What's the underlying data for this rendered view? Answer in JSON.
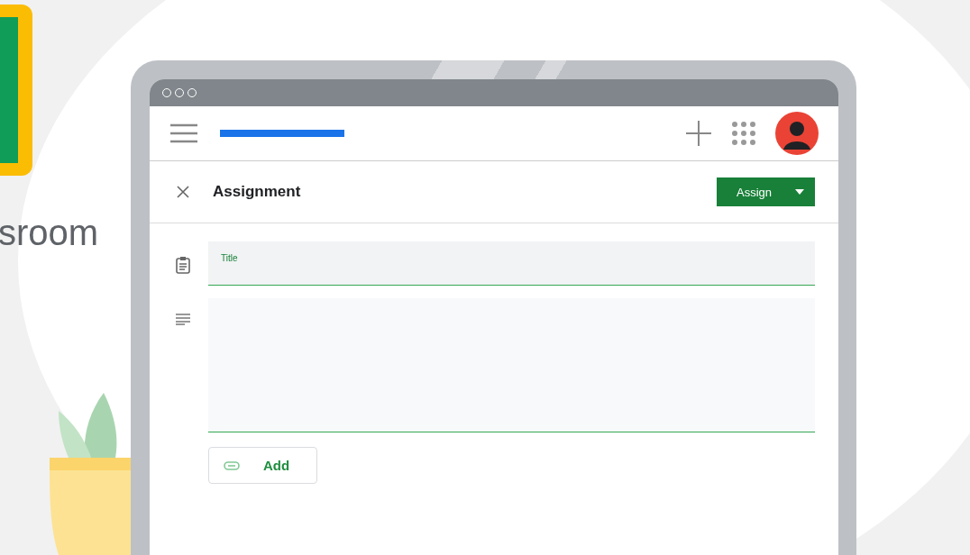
{
  "brand": {
    "wordmark": "sroom"
  },
  "dialog": {
    "title": "Assignment",
    "assign_button": "Assign",
    "title_field": {
      "label": "Title"
    },
    "add_button": "Add"
  }
}
